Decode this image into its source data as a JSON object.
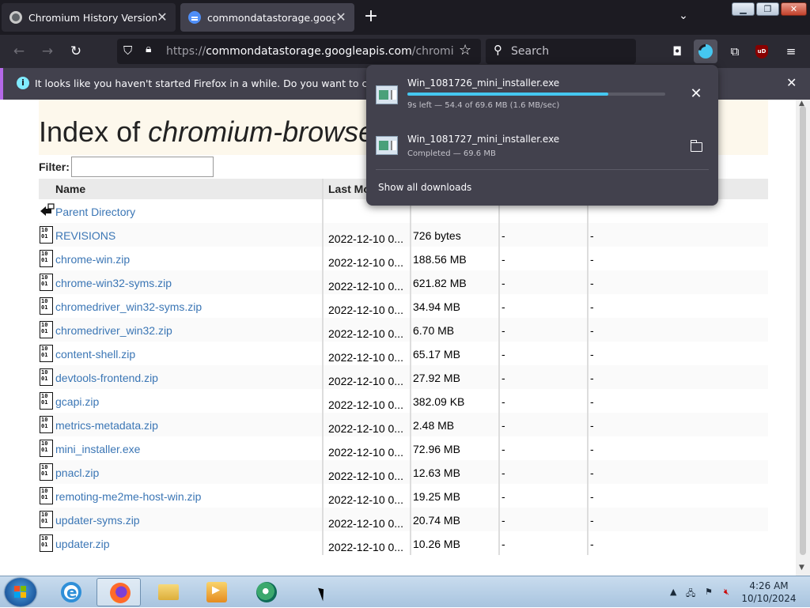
{
  "browser": {
    "tabs": [
      {
        "title": "Chromium History Versions Do"
      },
      {
        "title": "commondatastorage.googleap"
      }
    ],
    "url": {
      "prefix": "https://",
      "host": "commondatastorage.googleapis.com",
      "path": "/chromium-bro"
    },
    "search": {
      "placeholder": "Search"
    },
    "notification": {
      "message": "It looks like you haven't started Firefox in a while. Do you want to clean it up for"
    }
  },
  "page": {
    "title_prefix": "Index of ",
    "title_path": "chromium-browse",
    "filter_label": "Filter:",
    "headers": {
      "name": "Name",
      "last_modified": "Last Mo"
    },
    "parent": "Parent Directory",
    "files": [
      {
        "name": "REVISIONS",
        "date": "2022-12-10 0...",
        "size": "726 bytes",
        "d1": "-",
        "d2": "-"
      },
      {
        "name": "chrome-win.zip",
        "date": "2022-12-10 0...",
        "size": "188.56 MB",
        "d1": "-",
        "d2": "-"
      },
      {
        "name": "chrome-win32-syms.zip",
        "date": "2022-12-10 0...",
        "size": "621.82 MB",
        "d1": "-",
        "d2": "-"
      },
      {
        "name": "chromedriver_win32-syms.zip",
        "date": "2022-12-10 0...",
        "size": "34.94 MB",
        "d1": "-",
        "d2": "-"
      },
      {
        "name": "chromedriver_win32.zip",
        "date": "2022-12-10 0...",
        "size": "6.70 MB",
        "d1": "-",
        "d2": "-"
      },
      {
        "name": "content-shell.zip",
        "date": "2022-12-10 0...",
        "size": "65.17 MB",
        "d1": "-",
        "d2": "-"
      },
      {
        "name": "devtools-frontend.zip",
        "date": "2022-12-10 0...",
        "size": "27.92 MB",
        "d1": "-",
        "d2": "-"
      },
      {
        "name": "gcapi.zip",
        "date": "2022-12-10 0...",
        "size": "382.09 KB",
        "d1": "-",
        "d2": "-"
      },
      {
        "name": "metrics-metadata.zip",
        "date": "2022-12-10 0...",
        "size": "2.48 MB",
        "d1": "-",
        "d2": "-"
      },
      {
        "name": "mini_installer.exe",
        "date": "2022-12-10 0...",
        "size": "72.96 MB",
        "d1": "-",
        "d2": "-"
      },
      {
        "name": "pnacl.zip",
        "date": "2022-12-10 0...",
        "size": "12.63 MB",
        "d1": "-",
        "d2": "-"
      },
      {
        "name": "remoting-me2me-host-win.zip",
        "date": "2022-12-10 0...",
        "size": "19.25 MB",
        "d1": "-",
        "d2": "-"
      },
      {
        "name": "updater-syms.zip",
        "date": "2022-12-10 0...",
        "size": "20.74 MB",
        "d1": "-",
        "d2": "-"
      },
      {
        "name": "updater.zip",
        "date": "2022-12-10 0...",
        "size": "10.26 MB",
        "d1": "-",
        "d2": "-"
      }
    ]
  },
  "downloads": {
    "items": [
      {
        "name": "Win_1081726_mini_installer.exe",
        "status": "9s left — 54.4 of 69.6 MB (1.6 MB/sec)",
        "progress": 0.78
      },
      {
        "name": "Win_1081727_mini_installer.exe",
        "status": "Completed — 69.6 MB"
      }
    ],
    "show_all": "Show all downloads"
  },
  "taskbar": {
    "time": "4:26 AM",
    "date": "10/10/2024"
  },
  "colors": {
    "accent": "#45c7f0",
    "link": "#3b76b5",
    "notification_border": "#b569e8"
  }
}
